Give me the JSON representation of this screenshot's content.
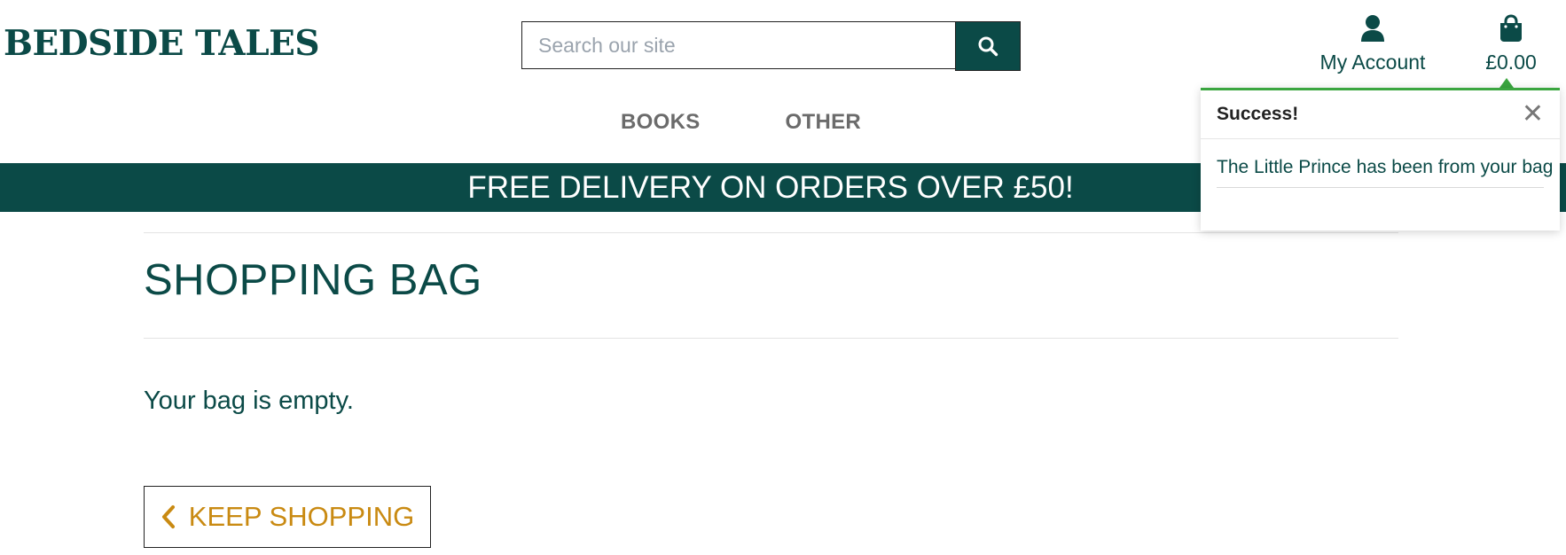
{
  "header": {
    "logo": "BEDSIDE TALES",
    "search_placeholder": "Search our site",
    "account_label": "My Account",
    "bag_total": "£0.00"
  },
  "nav": {
    "items": [
      {
        "label": "BOOKS"
      },
      {
        "label": "OTHER"
      }
    ]
  },
  "banner": {
    "text": "FREE DELIVERY ON ORDERS OVER £50!"
  },
  "main": {
    "title": "SHOPPING BAG",
    "empty_message": "Your bag is empty.",
    "keep_shopping_label": "KEEP SHOPPING"
  },
  "toast": {
    "title": "Success!",
    "message": "The Little Prince has been from your bag",
    "close_symbol": "✕"
  },
  "icons": {
    "search": "search-icon",
    "account": "user-icon",
    "bag": "shopping-bag-icon",
    "chevron": "chevron-left-icon"
  },
  "colors": {
    "brand": "#0b4a47",
    "accent": "#c98a12",
    "success": "#3aa53f"
  }
}
